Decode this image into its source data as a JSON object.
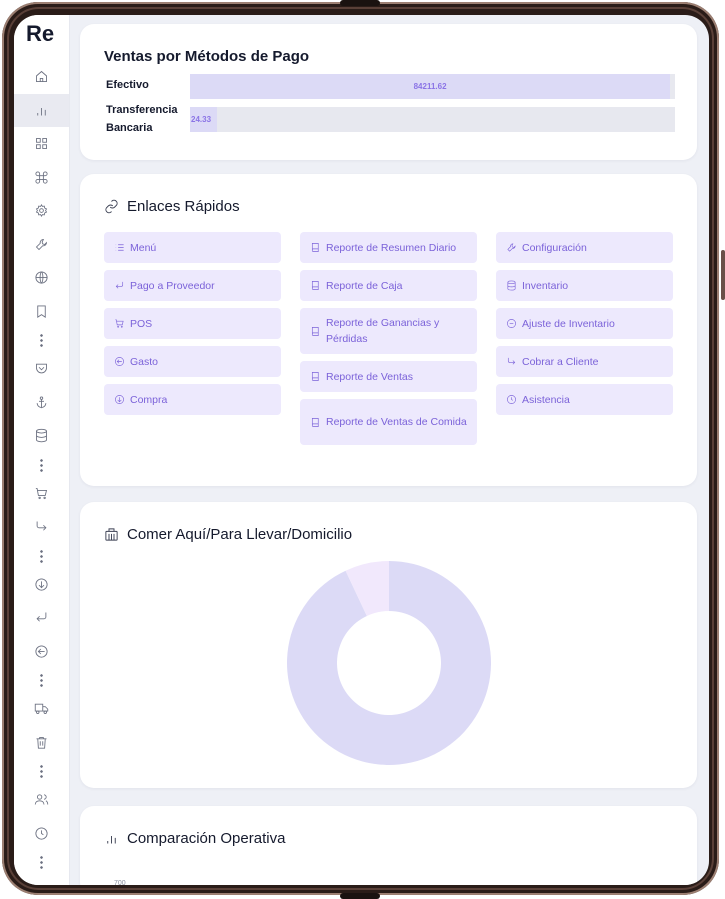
{
  "app": {
    "logo": "Re"
  },
  "sidebar": {
    "items": [
      {
        "icon": "home-icon"
      },
      {
        "icon": "bar-chart-icon",
        "active": true
      },
      {
        "icon": "grid-icon"
      },
      {
        "icon": "command-icon"
      },
      {
        "icon": "gear-icon"
      },
      {
        "icon": "wrench-icon"
      },
      {
        "icon": "globe-icon"
      },
      {
        "icon": "bookmark-icon"
      },
      {
        "icon": "more-dots-icon"
      },
      {
        "icon": "pocket-icon"
      },
      {
        "icon": "anchor-icon"
      },
      {
        "icon": "database-icon"
      },
      {
        "icon": "more-dots-icon"
      },
      {
        "icon": "cart-icon"
      },
      {
        "icon": "corner-down-right-icon"
      },
      {
        "icon": "more-dots-icon"
      },
      {
        "icon": "arrow-down-circle-icon"
      },
      {
        "icon": "corner-down-left-icon"
      },
      {
        "icon": "arrow-left-circle-icon"
      },
      {
        "icon": "more-dots-icon"
      },
      {
        "icon": "truck-icon"
      },
      {
        "icon": "trash-icon"
      },
      {
        "icon": "more-dots-icon"
      },
      {
        "icon": "users-icon"
      },
      {
        "icon": "clock-icon"
      },
      {
        "icon": "more-dots-icon"
      }
    ]
  },
  "payments": {
    "title": "Ventas por Métodos de Pago",
    "rows": [
      {
        "label": "Efectivo",
        "value": "84211.62",
        "fraction": 0.99
      },
      {
        "label_line1": "Transferencia",
        "label_line2": "Bancaria",
        "value": "24.33",
        "fraction": 0.055
      }
    ]
  },
  "quick_links": {
    "title": "Enlaces Rápidos",
    "title_icon": "link-icon",
    "col1": [
      {
        "label": "Menú",
        "icon": "list-icon"
      },
      {
        "label": "Pago a Proveedor",
        "icon": "corner-down-left-icon"
      },
      {
        "label": "POS",
        "icon": "cart-icon"
      },
      {
        "label": "Gasto",
        "icon": "arrow-left-circle-icon"
      },
      {
        "label": "Compra",
        "icon": "arrow-down-circle-icon"
      }
    ],
    "col2": [
      {
        "label": "Reporte de Resumen Diario",
        "icon": "book-icon"
      },
      {
        "label": "Reporte de Caja",
        "icon": "book-icon"
      },
      {
        "label": "Reporte de Ganancias y Pérdidas",
        "icon": "book-icon"
      },
      {
        "label": "Reporte de Ventas",
        "icon": "book-icon"
      },
      {
        "label": "Reporte de Ventas de Comida",
        "icon": "book-icon"
      }
    ],
    "col3": [
      {
        "label": "Configuración",
        "icon": "wrench-icon"
      },
      {
        "label": "Inventario",
        "icon": "database-icon"
      },
      {
        "label": "Ajuste de Inventario",
        "icon": "minus-circle-icon"
      },
      {
        "label": "Cobrar a Cliente",
        "icon": "corner-down-right-icon"
      },
      {
        "label": "Asistencia",
        "icon": "clock-icon"
      }
    ]
  },
  "dine": {
    "title": "Comer Aquí/Para Llevar/Domicilio",
    "title_icon": "building-icon",
    "chart_data": {
      "type": "pie",
      "slices": [
        {
          "fraction": 0.93,
          "color": "#dcdaf6"
        },
        {
          "fraction": 0.07,
          "color": "#f1e8fc"
        }
      ]
    }
  },
  "comparison": {
    "title": "Comparación Operativa",
    "title_icon": "bar-chart-icon",
    "first_tick": "700"
  },
  "colors": {
    "accent": "#7b62d9",
    "link_bg": "#ede9fd",
    "bar": "#dcdaf6"
  }
}
